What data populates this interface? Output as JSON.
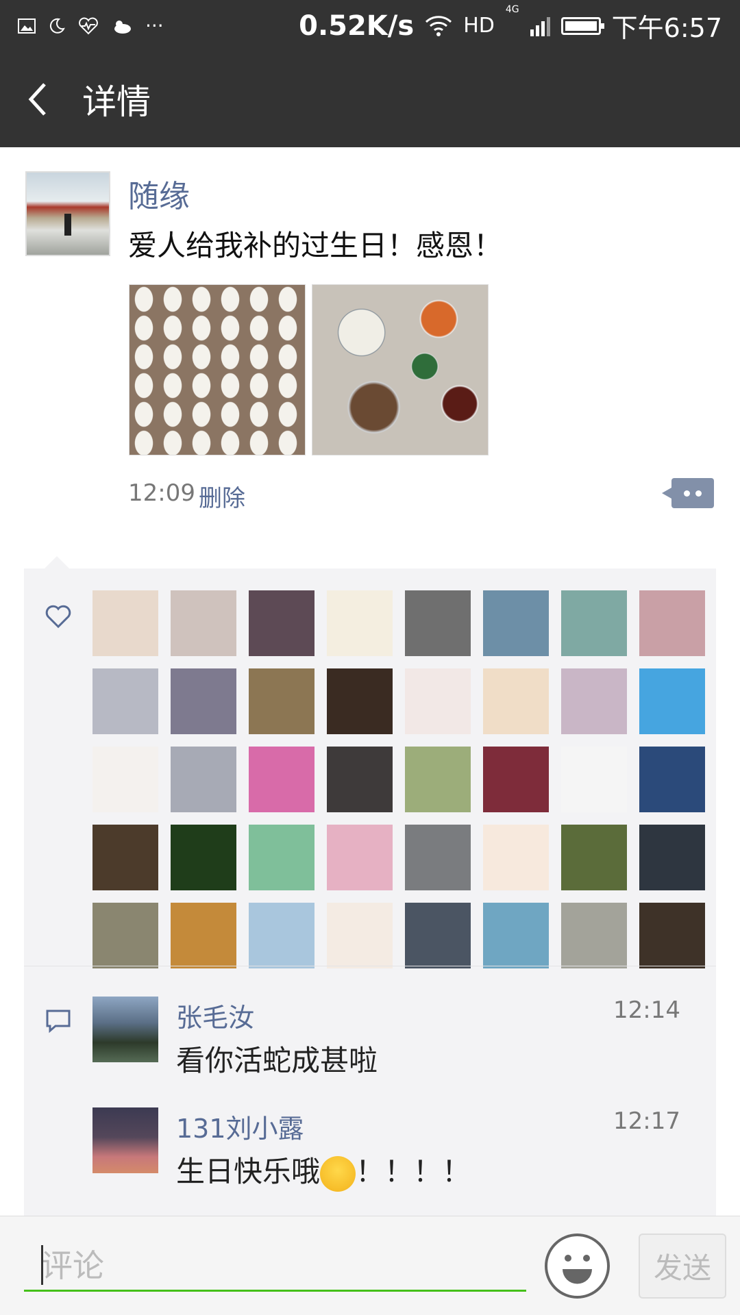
{
  "status_bar": {
    "speed": "0.52K/s",
    "network": "HD",
    "network_type": "4G",
    "time": "下午6:57",
    "icons": [
      "image-icon",
      "moon-icon",
      "heart-monitor-icon",
      "weather-icon",
      "more-dots-icon"
    ]
  },
  "header": {
    "title": "详情",
    "back_icon": "back-chevron-icon"
  },
  "post": {
    "author": "随缘",
    "text": "爱人给我补的过生日！感恩！",
    "time": "12:09",
    "delete_label": "删除"
  },
  "likes": {
    "icon": "heart-outline-icon",
    "avatar_colors": [
      "#e8d9cc",
      "#cfc2bd",
      "#5d4a55",
      "#f4eee0",
      "#6f6f6f",
      "#6d8fa7",
      "#7fa9a3",
      "#c9a0a6",
      "#b7b9c4",
      "#7e7a8f",
      "#8c7653",
      "#3a2b22",
      "#f2e8e6",
      "#f0ddc7",
      "#c9b6c6",
      "#46a5e0",
      "#f4f1ee",
      "#a7aab5",
      "#d86ba9",
      "#3e3a3a",
      "#9cad7a",
      "#7e2c3a",
      "#f5f5f5",
      "#2b4a7a",
      "#4c3b2b",
      "#1f3d1a",
      "#7fbf9a",
      "#e6b1c3",
      "#7a7c7f",
      "#f7e9dd",
      "#5b6c3a",
      "#2e3640",
      "#8a8670",
      "#c48a3a",
      "#a9c6dd",
      "#f4ebe3",
      "#4b5563",
      "#6fa6c2",
      "#a3a39a",
      "#3e3228"
    ]
  },
  "comments": [
    {
      "name": "张毛汝",
      "time": "12:14",
      "text": "看你活蛇成甚啦",
      "avatar_color": "#5b6f86"
    },
    {
      "name": "131刘小露",
      "time": "12:17",
      "text": "生日快乐哦",
      "suffix": "！！！！",
      "avatar_color": "#54475a"
    }
  ],
  "comment_icon": "chat-bubble-icon",
  "comment_bar": {
    "placeholder": "评论",
    "send_label": "发送",
    "emoji_icon": "emoji-icon"
  }
}
